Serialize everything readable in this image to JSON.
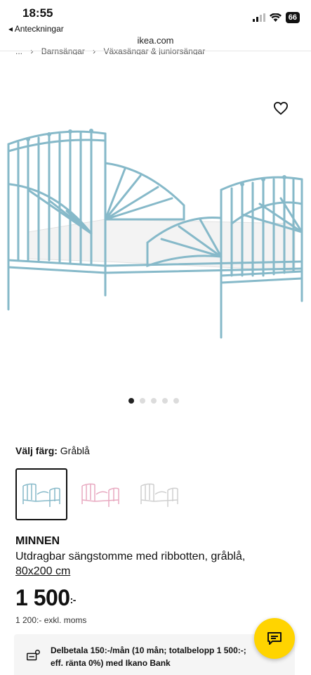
{
  "status_bar": {
    "time": "18:55",
    "back_app": "◂ Anteckningar",
    "battery": "66"
  },
  "browser": {
    "url": "ikea.com"
  },
  "breadcrumb": [
    "...",
    "›",
    "Barnsängar",
    "›",
    "Växasängar & juniorsängar"
  ],
  "gallery": {
    "image_count": 5,
    "active_index": 0
  },
  "color": {
    "label": "Välj färg:",
    "selected": "Gråblå",
    "swatches": [
      {
        "name": "Gråblå",
        "color": "#7fb3c4",
        "selected": true
      },
      {
        "name": "Rosa",
        "color": "#e8a9c0",
        "selected": false
      },
      {
        "name": "Vit",
        "color": "#d9d9d9",
        "selected": false
      }
    ]
  },
  "product": {
    "name": "MINNEN",
    "description": "Utdragbar sängstomme med ribbotten, gråblå,",
    "size": "80x200 cm",
    "price": "1 500",
    "price_suffix": ":-",
    "price_ex_vat": "1 200:- exkl. moms"
  },
  "financing": {
    "text": "Delbetala 150:-/mån (10 mån; totalbelopp 1 500:-; eff. ränta 0%) med Ikano Bank"
  },
  "colors": {
    "bed_frame": "#86b9c9",
    "chat_button": "#ffd400"
  }
}
